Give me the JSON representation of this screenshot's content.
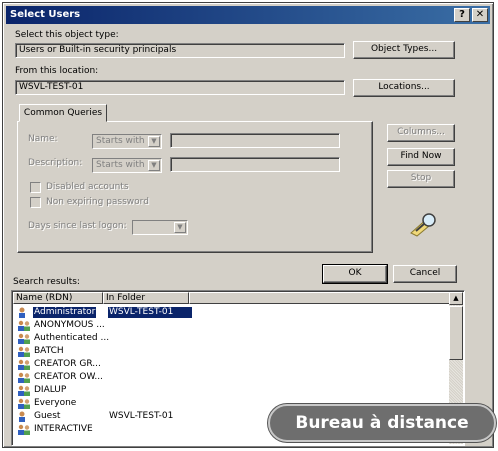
{
  "window": {
    "title": "Select Users",
    "help_glyph": "?",
    "close_glyph": "✕"
  },
  "object_type": {
    "label": "Select this object type:",
    "value": "Users or Built-in security principals",
    "button": "Object Types..."
  },
  "location": {
    "label": "From this location:",
    "value": "WSVL-TEST-01",
    "button": "Locations..."
  },
  "common_queries": {
    "tab": "Common Queries",
    "name_label": "Name:",
    "name_mode": "Starts with",
    "description_label": "Description:",
    "description_mode": "Starts with",
    "disabled_accounts": "Disabled accounts",
    "non_expiring": "Non expiring password",
    "days_label": "Days since last logon:",
    "columns_button": "Columns...",
    "find_now_button": "Find Now",
    "stop_button": "Stop"
  },
  "actions": {
    "ok": "OK",
    "cancel": "Cancel"
  },
  "results": {
    "label": "Search results:",
    "columns": [
      "Name (RDN)",
      "In Folder"
    ],
    "rows": [
      {
        "name": "Administrator",
        "folder": "WSVL-TEST-01",
        "icon": "user-icon",
        "selected": true
      },
      {
        "name": "ANONYMOUS ...",
        "folder": "",
        "icon": "group-icon",
        "selected": false
      },
      {
        "name": "Authenticated ...",
        "folder": "",
        "icon": "group-icon",
        "selected": false
      },
      {
        "name": "BATCH",
        "folder": "",
        "icon": "group-icon",
        "selected": false
      },
      {
        "name": "CREATOR GR...",
        "folder": "",
        "icon": "group-icon",
        "selected": false
      },
      {
        "name": "CREATOR OW...",
        "folder": "",
        "icon": "group-icon",
        "selected": false
      },
      {
        "name": "DIALUP",
        "folder": "",
        "icon": "group-icon",
        "selected": false
      },
      {
        "name": "Everyone",
        "folder": "",
        "icon": "group-icon",
        "selected": false
      },
      {
        "name": "Guest",
        "folder": "WSVL-TEST-01",
        "icon": "user-icon",
        "selected": false
      },
      {
        "name": "INTERACTIVE",
        "folder": "",
        "icon": "group-icon",
        "selected": false
      }
    ]
  },
  "overlay": {
    "text": "Bureau à distance"
  },
  "colors": {
    "title_start": "#0a246a",
    "title_end": "#3a6ea5",
    "face": "#d4d0c8",
    "selection": "#0a246a"
  }
}
